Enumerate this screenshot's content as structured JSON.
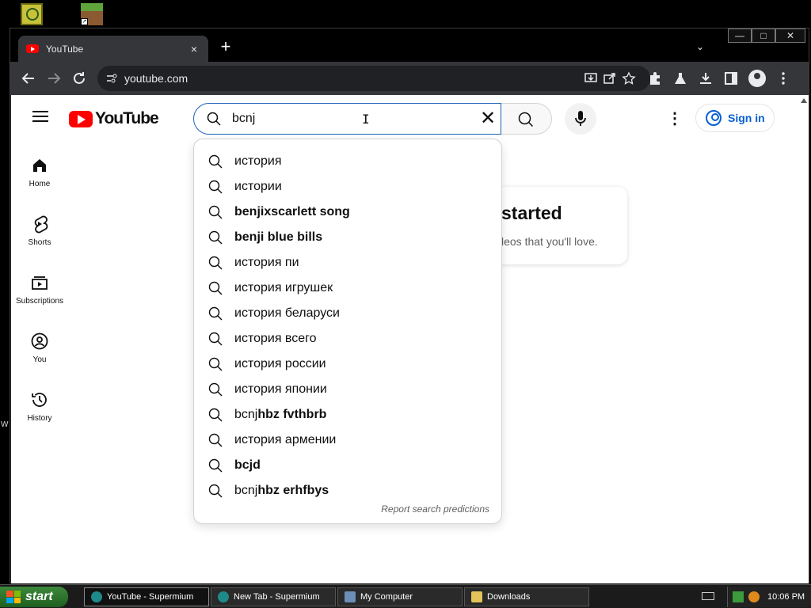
{
  "browser": {
    "tab_title": "YouTube",
    "tab_close": "×",
    "new_tab": "+",
    "tab_search": "⌄",
    "window_controls": {
      "minimize": "—",
      "maximize": "□",
      "close": "✕"
    },
    "url": "youtube.com"
  },
  "youtube": {
    "logo_text": "YouTube",
    "search": {
      "query": "bcnj",
      "clear": "✕"
    },
    "more": "⋮",
    "sign_in": "Sign in",
    "sidebar": [
      {
        "label": "Home",
        "icon": "home-icon"
      },
      {
        "label": "Shorts",
        "icon": "shorts-icon"
      },
      {
        "label": "Subscriptions",
        "icon": "subscriptions-icon"
      },
      {
        "label": "You",
        "icon": "you-icon"
      },
      {
        "label": "History",
        "icon": "history-icon"
      }
    ],
    "card": {
      "heading": "started",
      "subtext": "leos that you'll love."
    },
    "suggestions": [
      {
        "prefix": "",
        "rest": "история"
      },
      {
        "prefix": "",
        "rest": "истории"
      },
      {
        "prefix": "",
        "rest": "benjixscarlett song"
      },
      {
        "prefix": "",
        "rest": "benji blue bills"
      },
      {
        "prefix": "",
        "rest": "история пи"
      },
      {
        "prefix": "",
        "rest": "история игрушек"
      },
      {
        "prefix": "",
        "rest": "история беларуси"
      },
      {
        "prefix": "",
        "rest": "история всего"
      },
      {
        "prefix": "",
        "rest": "история россии"
      },
      {
        "prefix": "",
        "rest": "история японии"
      },
      {
        "prefix": "bcnj",
        "rest": "hbz fvthbrb"
      },
      {
        "prefix": "",
        "rest": "история армении"
      },
      {
        "prefix": "",
        "rest": "bcjd"
      },
      {
        "prefix": "bcnj",
        "rest": "hbz erhfbys"
      }
    ],
    "report": "Report search predictions"
  },
  "desktop": {
    "edge_letter": "W"
  },
  "taskbar": {
    "start": "start",
    "tasks": [
      {
        "label": "YouTube - Supermium"
      },
      {
        "label": "New Tab - Supermium"
      },
      {
        "label": "My Computer"
      },
      {
        "label": "Downloads"
      }
    ],
    "clock": "10:06 PM"
  },
  "colors": {
    "youtube_red": "#ff0000",
    "search_focus": "#1c62b9",
    "signin_blue": "#065fd4",
    "chrome_toolbar": "#35363a"
  }
}
